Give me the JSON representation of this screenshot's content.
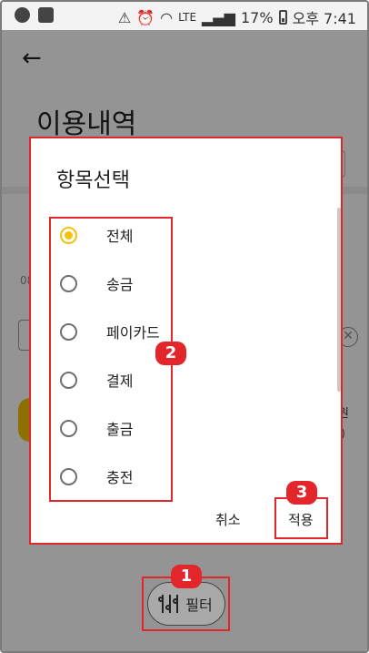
{
  "statusbar": {
    "lte": "LTE",
    "battery": "17%",
    "time": "오후 7:41"
  },
  "header": {
    "title": "이용내역"
  },
  "background": {
    "date_fragment": "08",
    "amount_fragment": "원",
    "note_fragment": "c)"
  },
  "dialog": {
    "title": "항목선택",
    "options": [
      {
        "label": "전체",
        "selected": true
      },
      {
        "label": "송금",
        "selected": false
      },
      {
        "label": "페이카드",
        "selected": false
      },
      {
        "label": "결제",
        "selected": false
      },
      {
        "label": "출금",
        "selected": false
      },
      {
        "label": "충전",
        "selected": false
      }
    ],
    "cancel_label": "취소",
    "apply_label": "적용"
  },
  "filter_button": {
    "label": "필터"
  },
  "annotations": {
    "badge_1": "1",
    "badge_2": "2",
    "badge_3": "3",
    "color": "#e3262b"
  },
  "colors": {
    "accent": "#f4c20d"
  }
}
